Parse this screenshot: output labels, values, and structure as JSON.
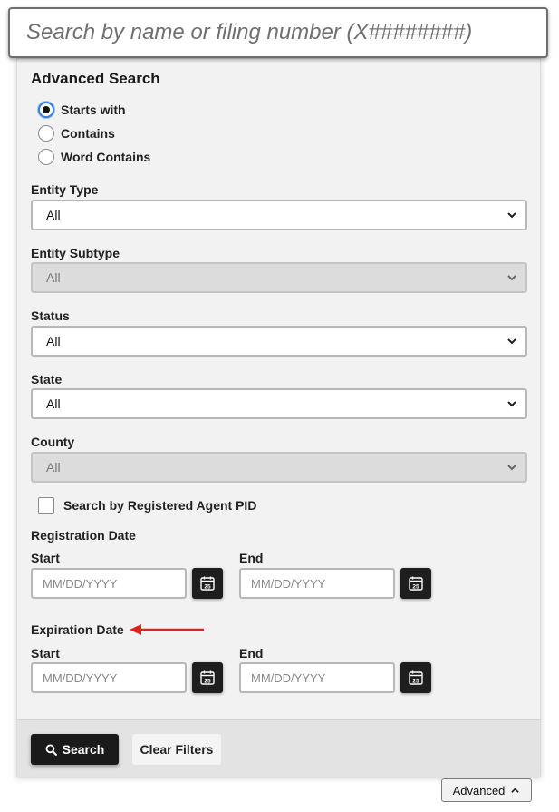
{
  "search": {
    "placeholder": "Search by name or filing number (X########)"
  },
  "advanced": {
    "title": "Advanced Search",
    "match_options": [
      {
        "label": "Starts with",
        "checked": true
      },
      {
        "label": "Contains",
        "checked": false
      },
      {
        "label": "Word Contains",
        "checked": false
      }
    ],
    "fields": [
      {
        "label": "Entity Type",
        "value": "All",
        "disabled": false
      },
      {
        "label": "Entity Subtype",
        "value": "All",
        "disabled": true
      },
      {
        "label": "Status",
        "value": "All",
        "disabled": false
      },
      {
        "label": "State",
        "value": "All",
        "disabled": false
      },
      {
        "label": "County",
        "value": "All",
        "disabled": true
      }
    ],
    "agent_checkbox": {
      "label": "Search by Registered Agent PID",
      "checked": false
    },
    "registration_date": {
      "label": "Registration Date",
      "start_label": "Start",
      "start_placeholder": "MM/DD/YYYY",
      "end_label": "End",
      "end_placeholder": "MM/DD/YYYY"
    },
    "expiration_date": {
      "label": "Expiration Date",
      "start_label": "Start",
      "start_placeholder": "MM/DD/YYYY",
      "end_label": "End",
      "end_placeholder": "MM/DD/YYYY"
    },
    "calendar_day": "25",
    "search_button": "Search",
    "clear_button": "Clear Filters"
  },
  "toggle": {
    "label": "Advanced"
  },
  "colors": {
    "accent": "#3b7ad8",
    "button_dark": "#1a1a1a",
    "arrow": "#e02020",
    "panel_bg": "#f2f2f2"
  }
}
